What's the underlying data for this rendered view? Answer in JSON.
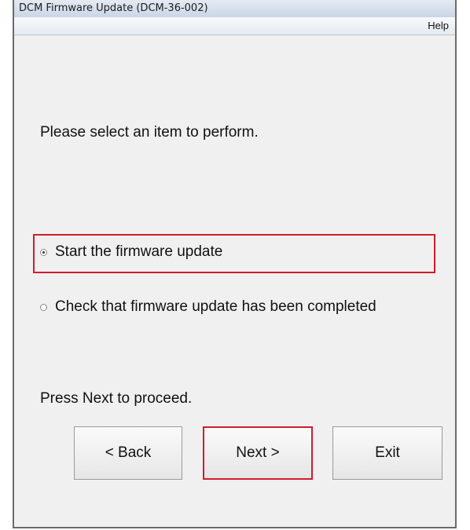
{
  "window": {
    "title": "DCM Firmware Update (DCM-36-002)"
  },
  "menu": {
    "help_label": "Help"
  },
  "main": {
    "prompt": "Please select an item to perform.",
    "options": [
      {
        "label": "Start the firmware update",
        "selected": true
      },
      {
        "label": "Check that firmware update has been completed",
        "selected": false
      }
    ],
    "instruction": "Press Next to proceed."
  },
  "buttons": {
    "back_label": "< Back",
    "next_label": "Next >",
    "exit_label": "Exit"
  },
  "colors": {
    "highlight": "#d01c2a"
  }
}
